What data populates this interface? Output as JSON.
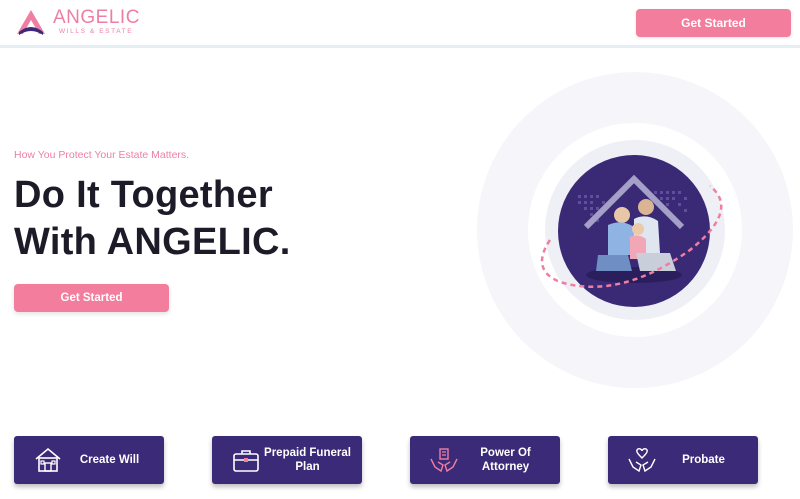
{
  "brand": {
    "name": "ANGELIC",
    "subtitle": "WILLS & ESTATE",
    "accent_color": "#ee7fa3",
    "primary_color": "#3b2a77"
  },
  "header": {
    "cta_label": "Get Started"
  },
  "hero": {
    "tagline": "How You Protect Your Estate Matters.",
    "headline_line1": "Do It Together",
    "headline_line2": "With ANGELIC.",
    "cta_label": "Get Started",
    "image_icon": "family-under-roof-photo"
  },
  "services": [
    {
      "label": "Create Will",
      "icon": "house-icon"
    },
    {
      "label": "Prepaid Funeral Plan",
      "icon": "briefcase-icon"
    },
    {
      "label": "Power Of Attorney",
      "icon": "hands-building-icon"
    },
    {
      "label": "Probate",
      "icon": "hands-heart-icon"
    }
  ]
}
